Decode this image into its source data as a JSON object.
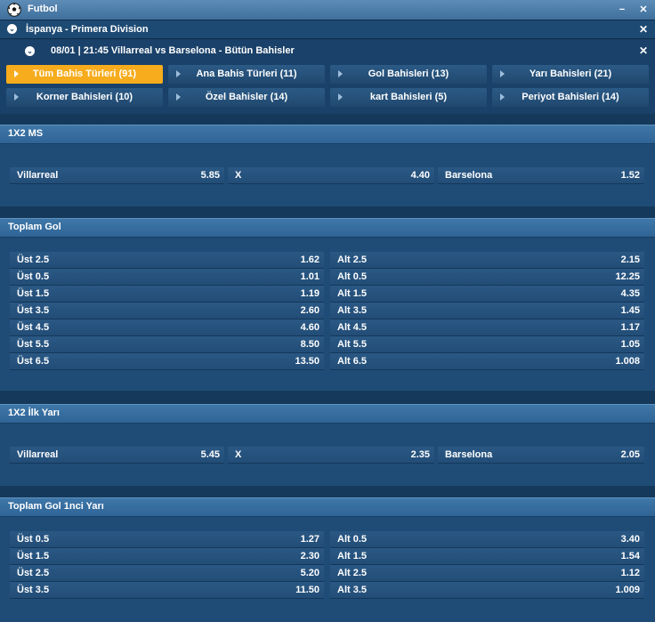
{
  "window": {
    "title": "Futbol",
    "ball_icon": "soccer-ball-icon",
    "minimize": "−",
    "close": "✕"
  },
  "league": {
    "label": "İspanya - Primera Division",
    "close": "✕"
  },
  "match": {
    "label": "08/01 | 21:45 Villarreal vs Barselona - Bütün Bahisler",
    "close": "✕"
  },
  "tabs": [
    {
      "label": "Tüm Bahis Türleri (91)",
      "active": true
    },
    {
      "label": "Ana Bahis Türleri (11)",
      "active": false
    },
    {
      "label": "Gol Bahisleri (13)",
      "active": false
    },
    {
      "label": "Yarı Bahisleri (21)",
      "active": false
    },
    {
      "label": "Korner Bahisleri (10)",
      "active": false
    },
    {
      "label": "Özel Bahisler (14)",
      "active": false
    },
    {
      "label": "kart Bahisleri (5)",
      "active": false
    },
    {
      "label": "Periyot Bahisleri (14)",
      "active": false
    }
  ],
  "sections": [
    {
      "title": "1X2 MS",
      "type": "1x2",
      "bets": [
        {
          "name": "Villarreal",
          "odds": "5.85"
        },
        {
          "name": "X",
          "odds": "4.40"
        },
        {
          "name": "Barselona",
          "odds": "1.52"
        }
      ]
    },
    {
      "title": "Toplam Gol",
      "type": "ou",
      "rows": [
        {
          "over": "Üst 2.5",
          "over_odds": "1.62",
          "under": "Alt 2.5",
          "under_odds": "2.15"
        },
        {
          "over": "Üst 0.5",
          "over_odds": "1.01",
          "under": "Alt 0.5",
          "under_odds": "12.25"
        },
        {
          "over": "Üst 1.5",
          "over_odds": "1.19",
          "under": "Alt 1.5",
          "under_odds": "4.35"
        },
        {
          "over": "Üst 3.5",
          "over_odds": "2.60",
          "under": "Alt 3.5",
          "under_odds": "1.45"
        },
        {
          "over": "Üst 4.5",
          "over_odds": "4.60",
          "under": "Alt 4.5",
          "under_odds": "1.17"
        },
        {
          "over": "Üst 5.5",
          "over_odds": "8.50",
          "under": "Alt 5.5",
          "under_odds": "1.05"
        },
        {
          "over": "Üst 6.5",
          "over_odds": "13.50",
          "under": "Alt 6.5",
          "under_odds": "1.008"
        }
      ]
    },
    {
      "title": "1X2 İlk Yarı",
      "type": "1x2",
      "bets": [
        {
          "name": "Villarreal",
          "odds": "5.45"
        },
        {
          "name": "X",
          "odds": "2.35"
        },
        {
          "name": "Barselona",
          "odds": "2.05"
        }
      ]
    },
    {
      "title": "Toplam Gol 1nci Yarı",
      "type": "ou",
      "rows": [
        {
          "over": "Üst 0.5",
          "over_odds": "1.27",
          "under": "Alt 0.5",
          "under_odds": "3.40"
        },
        {
          "over": "Üst 1.5",
          "over_odds": "2.30",
          "under": "Alt 1.5",
          "under_odds": "1.54"
        },
        {
          "over": "Üst 2.5",
          "over_odds": "5.20",
          "under": "Alt 2.5",
          "under_odds": "1.12"
        },
        {
          "over": "Üst 3.5",
          "over_odds": "11.50",
          "under": "Alt 3.5",
          "under_odds": "1.009"
        }
      ]
    }
  ]
}
